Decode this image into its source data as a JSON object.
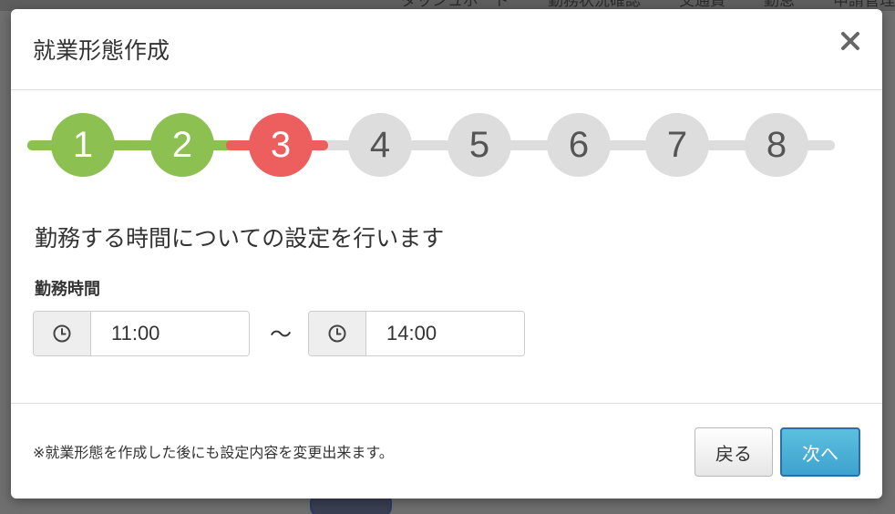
{
  "background_nav": {
    "items": [
      "ダッシュボード",
      "勤務状況確認",
      "交通費",
      "勤怠",
      "申請管理"
    ]
  },
  "modal": {
    "title": "就業形態作成",
    "close_icon": "close-icon"
  },
  "stepper": {
    "current_step": 3,
    "steps": [
      {
        "label": "1",
        "status": "completed"
      },
      {
        "label": "2",
        "status": "completed"
      },
      {
        "label": "3",
        "status": "current"
      },
      {
        "label": "4",
        "status": "upcoming"
      },
      {
        "label": "5",
        "status": "upcoming"
      },
      {
        "label": "6",
        "status": "upcoming"
      },
      {
        "label": "7",
        "status": "upcoming"
      },
      {
        "label": "8",
        "status": "upcoming"
      }
    ],
    "colors": {
      "completed": "#8cc152",
      "current": "#ed5f5f",
      "upcoming": "#dddddd",
      "upcoming_text": "#555555"
    }
  },
  "content": {
    "heading": "勤務する時間についての設定を行います",
    "field_label": "勤務時間",
    "start_time": "11:00",
    "separator": "〜",
    "end_time": "14:00",
    "clock_icon": "clock-icon"
  },
  "footer": {
    "note": "※就業形態を作成した後にも設定内容を変更出来ます。",
    "back_label": "戻る",
    "next_label": "次へ"
  }
}
